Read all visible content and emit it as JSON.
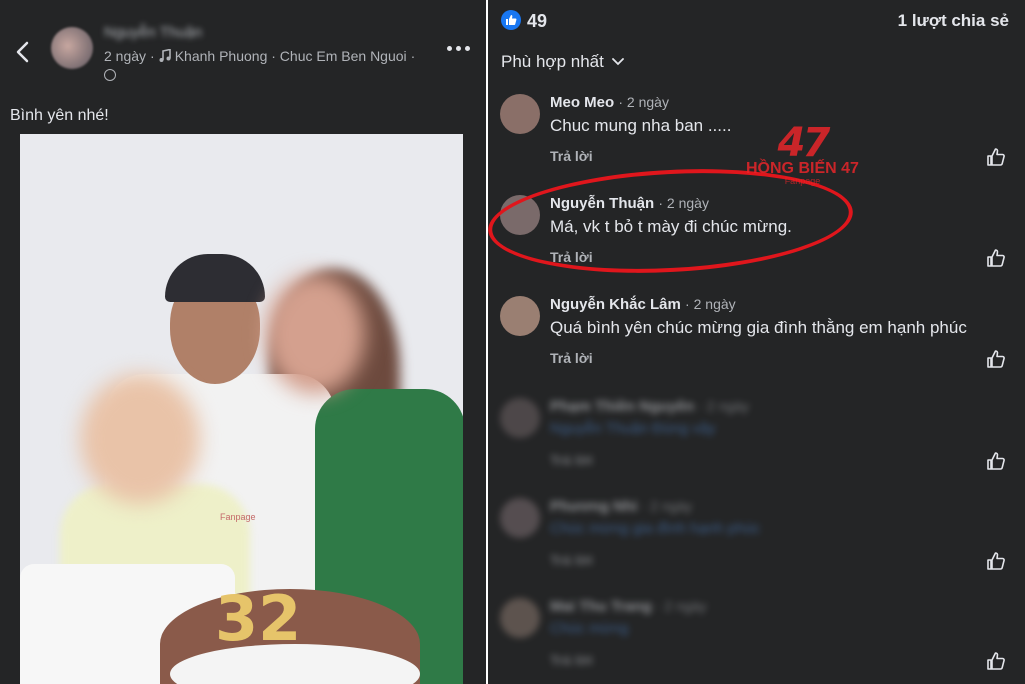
{
  "post": {
    "author": "Nguyễn Thuận",
    "time": "2 ngày",
    "music": "Khanh Phuong · Chuc Em Ben Nguoi",
    "caption": "Bình yên nhé!",
    "photo_number": "32",
    "photo_watermark": "Fanpage"
  },
  "stats": {
    "likes": "49",
    "shares": "1 lượt chia sẻ"
  },
  "sort_label": "Phù hợp nhất",
  "reply_label": "Trả lời",
  "comments": [
    {
      "name": "Meo Meo",
      "time": "2 ngày",
      "text": "Chuc mung nha ban .....",
      "avatar_color": "#8a6f68"
    },
    {
      "name": "Nguyễn Thuận",
      "time": "2 ngày",
      "text": "Má, vk t bỏ t mày đi chúc mừng.",
      "avatar_color": "#7a6a6a"
    },
    {
      "name": "Nguyễn Khắc Lâm",
      "time": "2 ngày",
      "text": "Quá bình yên chúc mừng gia đình thằng em hạnh phúc",
      "avatar_color": "#9a7f72"
    },
    {
      "name": "Phạm Thiên Nguyên",
      "time": "2 ngày",
      "text": "Nguyễn Thuận Đúng vậy",
      "avatar_color": "#6f6466"
    },
    {
      "name": "Phương Nhi",
      "time": "2 ngày",
      "text": "Chúc mừng gia đình hạnh phúc",
      "avatar_color": "#7d6f73"
    },
    {
      "name": "Mai Thu Trang",
      "time": "2 ngày",
      "text": "Chúc mừng",
      "avatar_color": "#8c7a70"
    }
  ],
  "watermark": {
    "logo": "47",
    "name": "HỒNG BIẾN 47",
    "sub": "Fanpage"
  },
  "colors": {
    "background": "#242526",
    "accent_blue": "#1877f2",
    "highlight_red": "#e0161c"
  }
}
